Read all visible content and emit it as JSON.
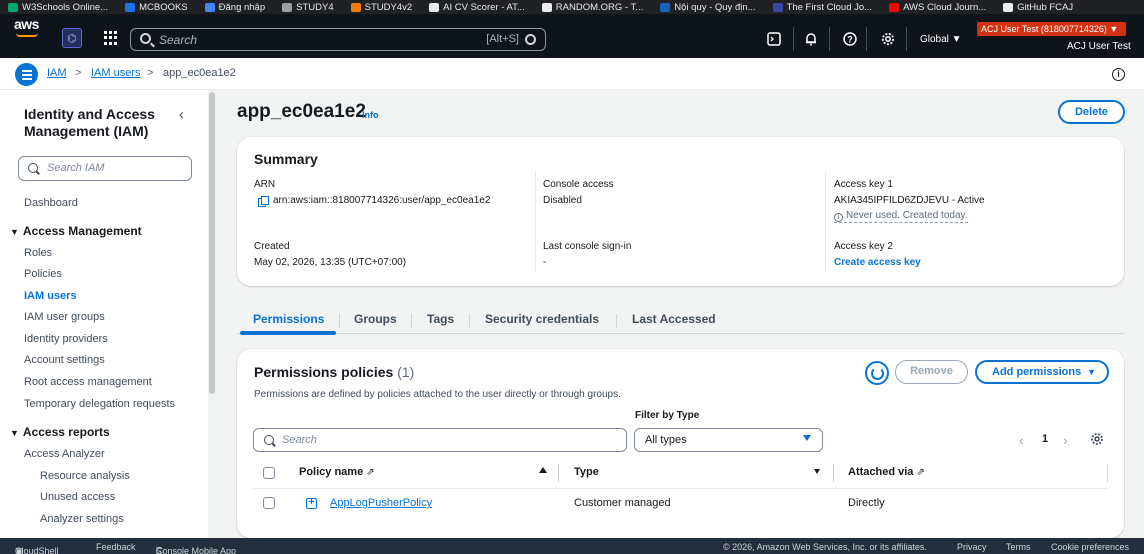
{
  "bookmarks": [
    {
      "label": "W3Schools Online...",
      "color": "#04aa6d"
    },
    {
      "label": "MCBOOKS",
      "color": "#1a73e8"
    },
    {
      "label": "Đăng nhập",
      "color": "#4285f4"
    },
    {
      "label": "STUDY4",
      "color": "#9aa0a6"
    },
    {
      "label": "STUDY4v2",
      "color": "#f57c00"
    },
    {
      "label": "AI CV Scorer - AT...",
      "color": "#e8eaed"
    },
    {
      "label": "RANDOM.ORG - T...",
      "color": "#e8eaed"
    },
    {
      "label": "Nội quy - Quy địn...",
      "color": "#1565c0"
    },
    {
      "label": "The First Cloud Jo...",
      "color": "#3949ab"
    },
    {
      "label": "AWS Cloud Journ...",
      "color": "#ff0000"
    },
    {
      "label": "GitHub FCAJ",
      "color": "#e8eaed"
    }
  ],
  "topnav": {
    "logo": "aws",
    "search_placeholder": "Search",
    "search_shortcut": "[Alt+S]",
    "region": "Global ▼",
    "account_badge": "ACJ User Test (818007714326) ▼",
    "account_name": "ACJ User Test",
    "icons": [
      "cloudshell-icon",
      "bell-icon",
      "help-icon",
      "settings-icon"
    ]
  },
  "breadcrumb": {
    "items": [
      "IAM",
      "IAM users",
      "app_ec0ea1e2"
    ],
    "separator": ">"
  },
  "sidebar": {
    "title": "Identity and Access Management (IAM)",
    "search_placeholder": "Search IAM",
    "dashboard": "Dashboard",
    "access_management": {
      "label": "Access Management",
      "items": [
        "Roles",
        "Policies",
        "IAM users",
        "IAM user groups",
        "Identity providers",
        "Account settings",
        "Root access management",
        "Temporary delegation requests"
      ],
      "active": "IAM users"
    },
    "access_reports": {
      "label": "Access reports",
      "items": [
        "Access Analyzer"
      ],
      "subitems": [
        "Resource analysis",
        "Unused access",
        "Analyzer settings"
      ]
    }
  },
  "page": {
    "title": "app_ec0ea1e2",
    "info": "Info",
    "delete": "Delete"
  },
  "summary": {
    "heading": "Summary",
    "arn_label": "ARN",
    "arn_value": "arn:aws:iam::818007714326:user/app_ec0ea1e2",
    "console_access_label": "Console access",
    "console_access_value": "Disabled",
    "access_key1_label": "Access key 1",
    "access_key1_value": "AKIA345IPFILD6ZDJEVU - Active",
    "access_key1_note": "Never used. Created today.",
    "created_label": "Created",
    "created_value": "May 02, 2026, 13:35 (UTC+07:00)",
    "last_signin_label": "Last console sign-in",
    "last_signin_value": "-",
    "access_key2_label": "Access key 2",
    "access_key2_link": "Create access key"
  },
  "tabs": [
    "Permissions",
    "Groups",
    "Tags",
    "Security credentials",
    "Last Accessed"
  ],
  "active_tab": "Permissions",
  "permissions": {
    "heading": "Permissions policies",
    "count": "(1)",
    "description": "Permissions are defined by policies attached to the user directly or through groups.",
    "refresh_icon": "refresh-icon",
    "remove": "Remove",
    "add_permissions": "Add permissions",
    "filter_label": "Filter by Type",
    "search_placeholder": "Search",
    "filter_value": "All types",
    "page_number": "1",
    "columns": [
      "Policy name",
      "Type",
      "Attached via"
    ],
    "rows": [
      {
        "name": "AppLogPusherPolicy",
        "type": "Customer managed",
        "attached_via": "Directly"
      }
    ]
  },
  "footer": {
    "cloudshell": "CloudShell",
    "feedback": "Feedback",
    "console_mobile": "Console Mobile App",
    "copyright": "© 2026, Amazon Web Services, Inc. or its affiliates.",
    "privacy": "Privacy",
    "terms": "Terms",
    "cookie": "Cookie preferences"
  },
  "colors": {
    "accent": "#0972d3",
    "nav_bg": "#0f141a",
    "account_badge": "#d13212",
    "footer_bg": "#232f3e"
  }
}
